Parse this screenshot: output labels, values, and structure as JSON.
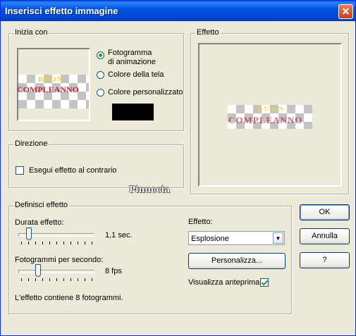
{
  "window": {
    "title": "Inserisci effetto immagine",
    "close_glyph": "✕"
  },
  "start_group": {
    "legend": "Inizia con",
    "preview_text": [
      "BUON",
      "COMPLEANNO"
    ],
    "options": [
      {
        "label_line1": "Fotogramma",
        "label_line2": "di animazione",
        "selected": true
      },
      {
        "label": "Colore della tela",
        "selected": false
      },
      {
        "label": "Colore personalizzato",
        "selected": false
      }
    ],
    "custom_color": "#000000"
  },
  "direction_group": {
    "legend": "Direzione",
    "reverse_label": "Esegui effetto al contrario",
    "reverse_checked": false
  },
  "effect_preview_group": {
    "legend": "Effetto",
    "preview_text": [
      "BUON",
      "COMPLEANNO"
    ]
  },
  "watermark": "Pinuccia",
  "define_group": {
    "legend": "Definisci effetto",
    "duration_label": "Durata effetto:",
    "duration_value": "1,1 sec.",
    "fps_label": "Fotogrammi per secondo:",
    "fps_value": "8 fps",
    "info": "L'effetto contiene 8 fotogrammi.",
    "effect_label": "Effetto:",
    "effect_selected": "Esplosione",
    "customize_button": "Personalizza...",
    "show_preview_label": "Visualizza anteprima",
    "show_preview_checked": true
  },
  "buttons": {
    "ok": "OK",
    "cancel": "Annulla",
    "help": "?"
  },
  "colors": {
    "title_bar": "#0054e3",
    "dialog_bg": "#ece9d8",
    "wordart_yellow": "#f2d23a",
    "wordart_red": "#c0283c"
  }
}
